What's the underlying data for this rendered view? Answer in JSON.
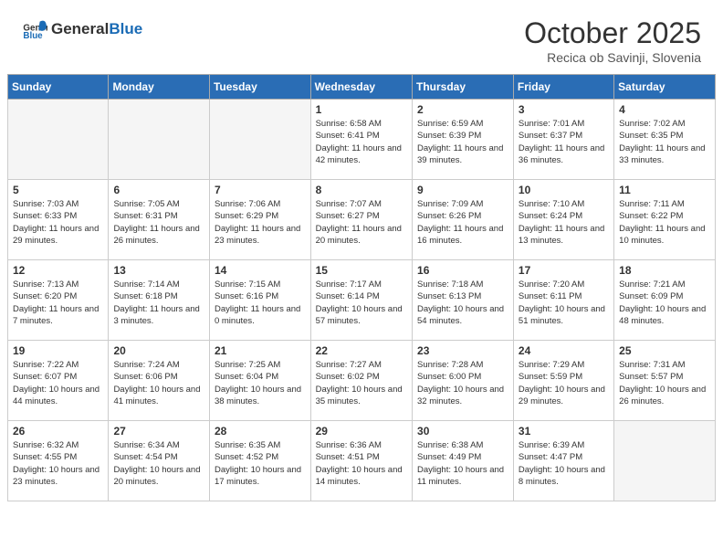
{
  "header": {
    "logo_general": "General",
    "logo_blue": "Blue",
    "title": "October 2025",
    "subtitle": "Recica ob Savinji, Slovenia"
  },
  "weekdays": [
    "Sunday",
    "Monday",
    "Tuesday",
    "Wednesday",
    "Thursday",
    "Friday",
    "Saturday"
  ],
  "weeks": [
    [
      {
        "day": "",
        "info": ""
      },
      {
        "day": "",
        "info": ""
      },
      {
        "day": "",
        "info": ""
      },
      {
        "day": "1",
        "info": "Sunrise: 6:58 AM\nSunset: 6:41 PM\nDaylight: 11 hours and 42 minutes."
      },
      {
        "day": "2",
        "info": "Sunrise: 6:59 AM\nSunset: 6:39 PM\nDaylight: 11 hours and 39 minutes."
      },
      {
        "day": "3",
        "info": "Sunrise: 7:01 AM\nSunset: 6:37 PM\nDaylight: 11 hours and 36 minutes."
      },
      {
        "day": "4",
        "info": "Sunrise: 7:02 AM\nSunset: 6:35 PM\nDaylight: 11 hours and 33 minutes."
      }
    ],
    [
      {
        "day": "5",
        "info": "Sunrise: 7:03 AM\nSunset: 6:33 PM\nDaylight: 11 hours and 29 minutes."
      },
      {
        "day": "6",
        "info": "Sunrise: 7:05 AM\nSunset: 6:31 PM\nDaylight: 11 hours and 26 minutes."
      },
      {
        "day": "7",
        "info": "Sunrise: 7:06 AM\nSunset: 6:29 PM\nDaylight: 11 hours and 23 minutes."
      },
      {
        "day": "8",
        "info": "Sunrise: 7:07 AM\nSunset: 6:27 PM\nDaylight: 11 hours and 20 minutes."
      },
      {
        "day": "9",
        "info": "Sunrise: 7:09 AM\nSunset: 6:26 PM\nDaylight: 11 hours and 16 minutes."
      },
      {
        "day": "10",
        "info": "Sunrise: 7:10 AM\nSunset: 6:24 PM\nDaylight: 11 hours and 13 minutes."
      },
      {
        "day": "11",
        "info": "Sunrise: 7:11 AM\nSunset: 6:22 PM\nDaylight: 11 hours and 10 minutes."
      }
    ],
    [
      {
        "day": "12",
        "info": "Sunrise: 7:13 AM\nSunset: 6:20 PM\nDaylight: 11 hours and 7 minutes."
      },
      {
        "day": "13",
        "info": "Sunrise: 7:14 AM\nSunset: 6:18 PM\nDaylight: 11 hours and 3 minutes."
      },
      {
        "day": "14",
        "info": "Sunrise: 7:15 AM\nSunset: 6:16 PM\nDaylight: 11 hours and 0 minutes."
      },
      {
        "day": "15",
        "info": "Sunrise: 7:17 AM\nSunset: 6:14 PM\nDaylight: 10 hours and 57 minutes."
      },
      {
        "day": "16",
        "info": "Sunrise: 7:18 AM\nSunset: 6:13 PM\nDaylight: 10 hours and 54 minutes."
      },
      {
        "day": "17",
        "info": "Sunrise: 7:20 AM\nSunset: 6:11 PM\nDaylight: 10 hours and 51 minutes."
      },
      {
        "day": "18",
        "info": "Sunrise: 7:21 AM\nSunset: 6:09 PM\nDaylight: 10 hours and 48 minutes."
      }
    ],
    [
      {
        "day": "19",
        "info": "Sunrise: 7:22 AM\nSunset: 6:07 PM\nDaylight: 10 hours and 44 minutes."
      },
      {
        "day": "20",
        "info": "Sunrise: 7:24 AM\nSunset: 6:06 PM\nDaylight: 10 hours and 41 minutes."
      },
      {
        "day": "21",
        "info": "Sunrise: 7:25 AM\nSunset: 6:04 PM\nDaylight: 10 hours and 38 minutes."
      },
      {
        "day": "22",
        "info": "Sunrise: 7:27 AM\nSunset: 6:02 PM\nDaylight: 10 hours and 35 minutes."
      },
      {
        "day": "23",
        "info": "Sunrise: 7:28 AM\nSunset: 6:00 PM\nDaylight: 10 hours and 32 minutes."
      },
      {
        "day": "24",
        "info": "Sunrise: 7:29 AM\nSunset: 5:59 PM\nDaylight: 10 hours and 29 minutes."
      },
      {
        "day": "25",
        "info": "Sunrise: 7:31 AM\nSunset: 5:57 PM\nDaylight: 10 hours and 26 minutes."
      }
    ],
    [
      {
        "day": "26",
        "info": "Sunrise: 6:32 AM\nSunset: 4:55 PM\nDaylight: 10 hours and 23 minutes."
      },
      {
        "day": "27",
        "info": "Sunrise: 6:34 AM\nSunset: 4:54 PM\nDaylight: 10 hours and 20 minutes."
      },
      {
        "day": "28",
        "info": "Sunrise: 6:35 AM\nSunset: 4:52 PM\nDaylight: 10 hours and 17 minutes."
      },
      {
        "day": "29",
        "info": "Sunrise: 6:36 AM\nSunset: 4:51 PM\nDaylight: 10 hours and 14 minutes."
      },
      {
        "day": "30",
        "info": "Sunrise: 6:38 AM\nSunset: 4:49 PM\nDaylight: 10 hours and 11 minutes."
      },
      {
        "day": "31",
        "info": "Sunrise: 6:39 AM\nSunset: 4:47 PM\nDaylight: 10 hours and 8 minutes."
      },
      {
        "day": "",
        "info": ""
      }
    ]
  ]
}
